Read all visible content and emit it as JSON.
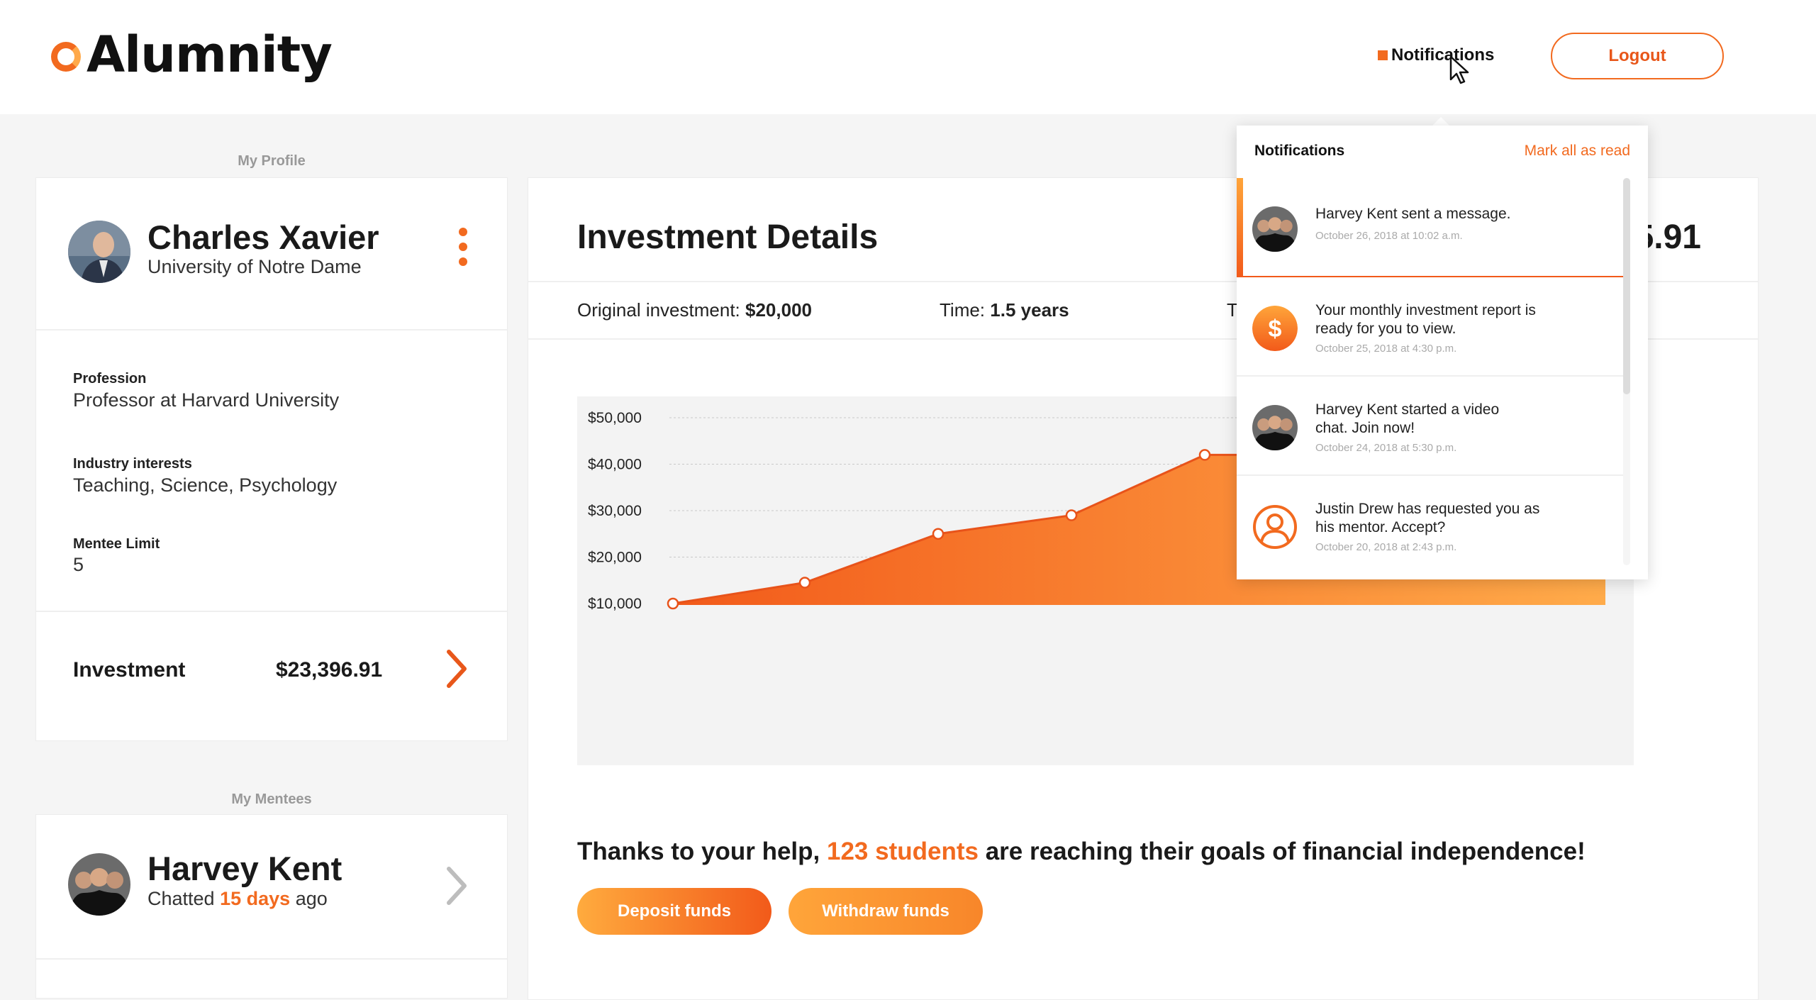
{
  "app": {
    "name": "Alumnity"
  },
  "header": {
    "notifications_label": "Notifications",
    "logout_label": "Logout"
  },
  "profile": {
    "section_label": "My Profile",
    "name": "Charles Xavier",
    "school": "University of Notre Dame",
    "fields": [
      {
        "label": "Profession",
        "value": "Professor at Harvard University"
      },
      {
        "label": "Industry interests",
        "value": "Teaching, Science, Psychology"
      },
      {
        "label": "Mentee Limit",
        "value": "5"
      }
    ],
    "investment_label": "Investment",
    "investment_value": "$23,396.91"
  },
  "mentees": {
    "section_label": "My Mentees",
    "items": [
      {
        "name": "Harvey Kent",
        "chatted_prefix": "Chatted",
        "chatted_value": "15 days",
        "chatted_suffix": "ago"
      }
    ]
  },
  "investment": {
    "title": "Investment Details",
    "amount_visible": "5.91",
    "original_label": "Original investment:",
    "original_value": "$20,000",
    "time_label": "Time:",
    "time_value": "1.5 years",
    "third_label_visible": "T"
  },
  "chart_data": {
    "type": "area",
    "y_ticks": [
      "$50,000",
      "$40,000",
      "$30,000",
      "$20,000",
      "$10,000"
    ],
    "ylim": [
      10000,
      50000
    ],
    "x": [
      0,
      1,
      2,
      3,
      4,
      5,
      6,
      7
    ],
    "values": [
      10000,
      14500,
      25000,
      29000,
      42000,
      42000,
      41000,
      40000
    ],
    "grid": true,
    "fill_colors": [
      "#f25a1a",
      "#ffa94a"
    ]
  },
  "thanks": {
    "prefix": "Thanks to your help,",
    "highlight": "123 students",
    "suffix": "are reaching their goals of financial independence!"
  },
  "buttons": {
    "deposit": "Deposit funds",
    "withdraw": "Withdraw funds"
  },
  "notifications": {
    "title": "Notifications",
    "mark_all": "Mark all as read",
    "items": [
      {
        "icon": "avatar-harvey",
        "text": "Harvey Kent sent a message.",
        "time": "October 26, 2018 at 10:02 a.m."
      },
      {
        "icon": "dollar-icon",
        "text": "Your monthly investment report is ready for you to view.",
        "time": "October 25, 2018 at 4:30 p.m."
      },
      {
        "icon": "avatar-harvey",
        "text": "Harvey Kent started a video chat. Join now!",
        "time": "October 24, 2018 at 5:30 p.m."
      },
      {
        "icon": "user-circle-icon",
        "text": "Justin Drew has requested you as his mentor. Accept?",
        "time": "October 20, 2018 at 2:43 p.m."
      }
    ]
  },
  "colors": {
    "accent": "#f26a1f",
    "accent_light": "#ffa94a"
  }
}
